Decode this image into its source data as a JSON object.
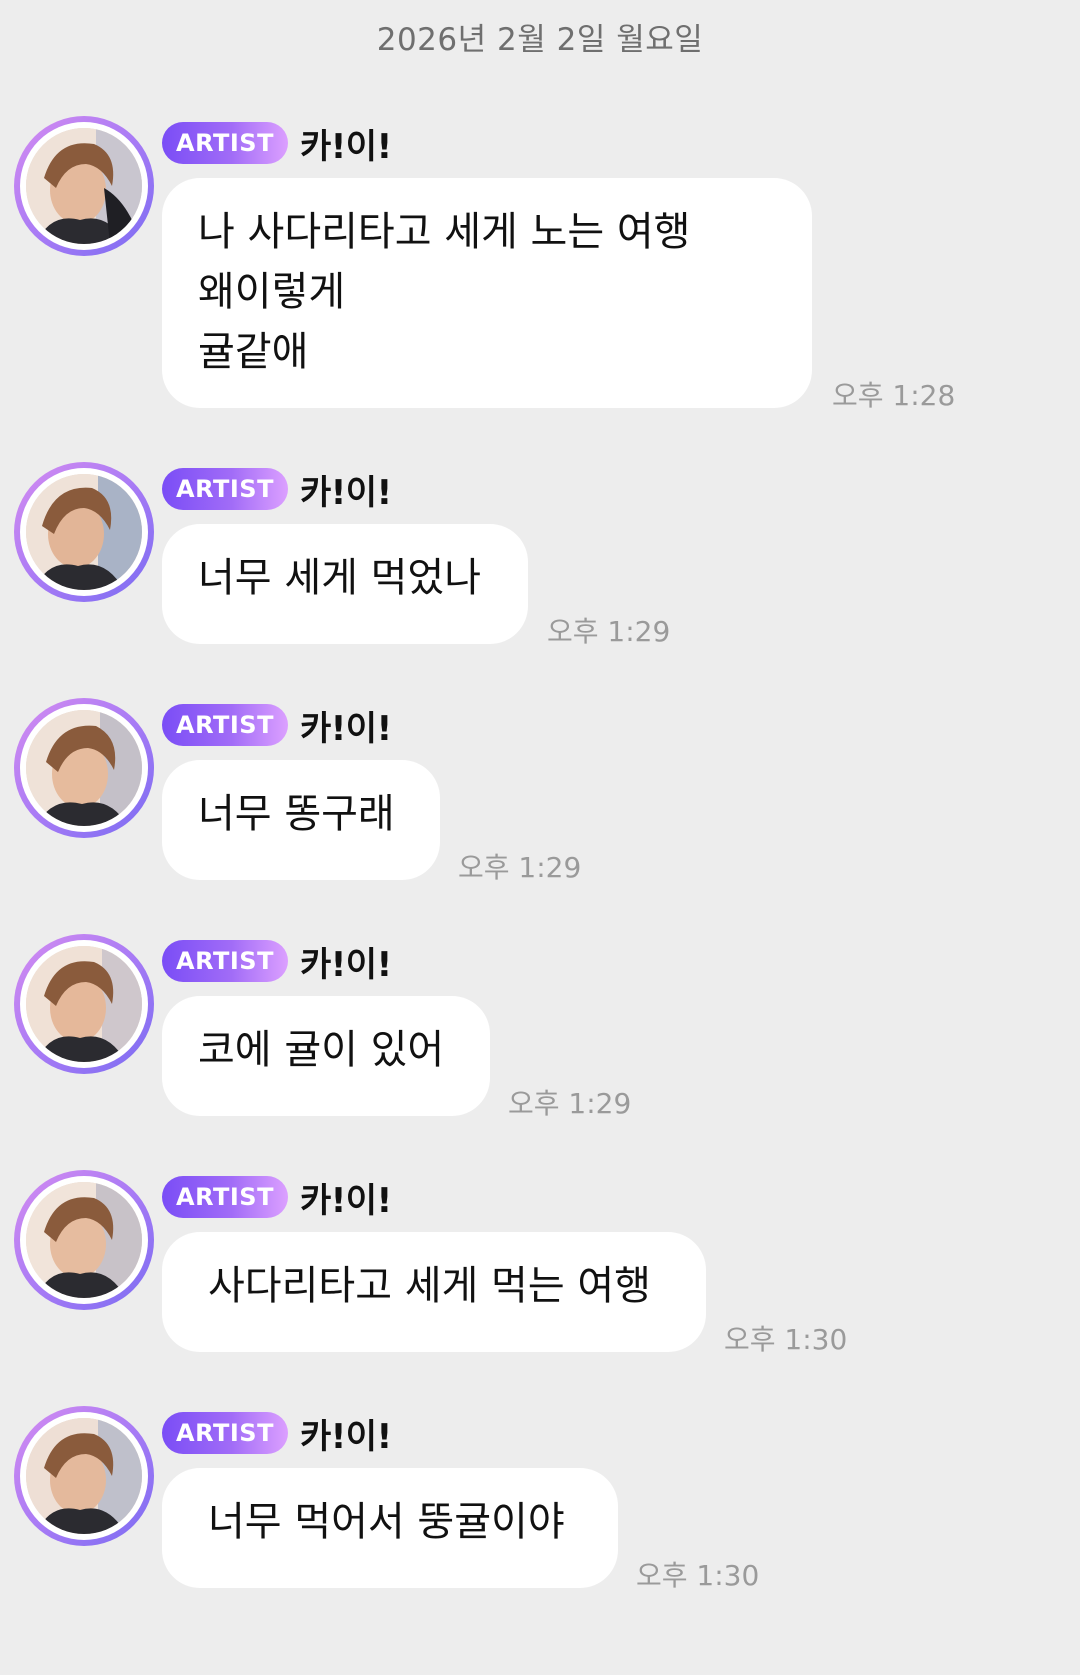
{
  "date_header": "2026년 2월 2일 월요일",
  "colors": {
    "background": "#ededed",
    "bubble": "#ffffff",
    "badge_start": "#7a4df6",
    "badge_end": "#dca0ff",
    "timestamp": "#9a9a9a"
  },
  "messages": [
    {
      "badge": "ARTIST",
      "sender": "카!이!",
      "text": "나 사다리타고 세게 노는 여행\n왜이렇게\n귤같애",
      "time": "오후 1:28"
    },
    {
      "badge": "ARTIST",
      "sender": "카!이!",
      "text": "너무 세게 먹었나",
      "time": "오후 1:29"
    },
    {
      "badge": "ARTIST",
      "sender": "카!이!",
      "text": "너무 똥구래",
      "time": "오후 1:29"
    },
    {
      "badge": "ARTIST",
      "sender": "카!이!",
      "text": "코에 귤이 있어",
      "time": "오후 1:29"
    },
    {
      "badge": "ARTIST",
      "sender": "카!이!",
      "text": "사다리타고 세게 먹는 여행",
      "time": "오후 1:30"
    },
    {
      "badge": "ARTIST",
      "sender": "카!이!",
      "text": "너무 먹어서 뚱귤이야",
      "time": "오후 1:30"
    }
  ]
}
